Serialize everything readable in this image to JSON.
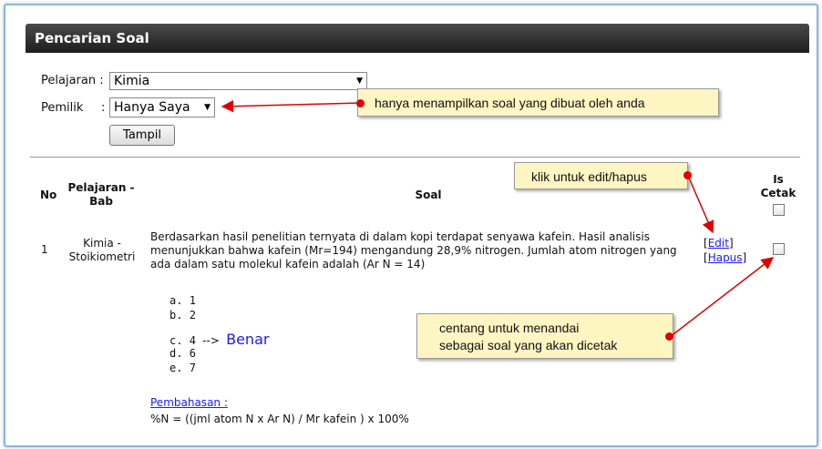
{
  "panel": {
    "title": "Pencarian Soal"
  },
  "filters": {
    "subject_label": "Pelajaran :",
    "subject_value": "Kimia",
    "owner_label": "Pemilik",
    "owner_colon": ":",
    "owner_value": "Hanya Saya",
    "show_button": "Tampil"
  },
  "table": {
    "headers": {
      "no": "No",
      "subject": "Pelajaran - Bab",
      "question": "Soal",
      "print": "Is Cetak"
    },
    "rows": [
      {
        "no": "1",
        "subject": "Kimia - Stoikiometri",
        "question": "Berdasarkan hasil penelitian ternyata di dalam kopi terdapat senyawa kafein. Hasil analisis menunjukkan bahwa kafein (Mr=194) mengandung 28,9% nitrogen. Jumlah atom nitrogen yang ada dalam satu molekul kafein adalah (Ar N = 14)",
        "options": [
          {
            "letter": "a.",
            "text": "1"
          },
          {
            "letter": "b.",
            "text": "2"
          },
          {
            "letter": "c.",
            "text": "4"
          },
          {
            "letter": "d.",
            "text": "6"
          },
          {
            "letter": "e.",
            "text": "7"
          }
        ],
        "correct_arrow": "-->",
        "correct_label": "Benar",
        "edit_label": "Edit",
        "delete_label": "Hapus",
        "discussion_label": "Pembahasan :",
        "discussion_text": "%N = ((jml atom N x Ar N) / Mr kafein ) x 100%"
      }
    ]
  },
  "annotations": {
    "owner_note": "hanya menampilkan soal yang dibuat oleh anda",
    "edit_note": "klik untuk edit/hapus",
    "check_note_line1": "centang untuk menandai",
    "check_note_line2": "sebagai soal yang akan dicetak"
  },
  "colors": {
    "header_bg": "#2b2b2b",
    "callout_bg": "#fdf5c2",
    "arrow": "#e00000",
    "link": "#1a1aff"
  }
}
